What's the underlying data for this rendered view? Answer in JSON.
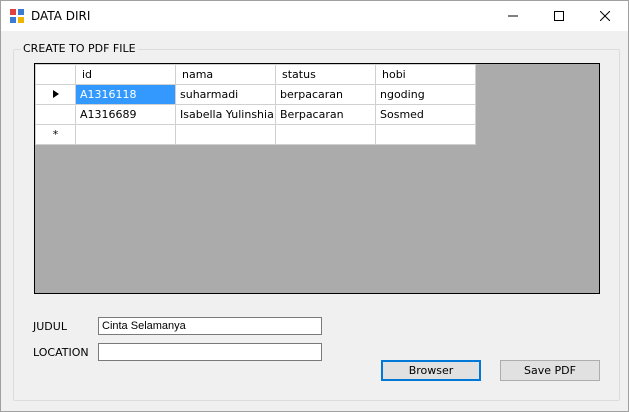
{
  "window": {
    "title": "DATA DIRI"
  },
  "group": {
    "title": "CREATE TO PDF FILE"
  },
  "grid": {
    "columns": [
      "id",
      "nama",
      "status",
      "hobi"
    ],
    "rows": [
      {
        "id": "A1316118",
        "nama": "suharmadi",
        "status": "berpacaran",
        "hobi": "ngoding"
      },
      {
        "id": "A1316689",
        "nama": "Isabella Yulinshia...",
        "status": "Berpacaran",
        "hobi": "Sosmed"
      }
    ],
    "new_row_marker": "*"
  },
  "form": {
    "judul_label": "JUDUL",
    "judul_value": "Cinta Selamanya",
    "location_label": "LOCATION",
    "location_value": ""
  },
  "buttons": {
    "browser": "Browser",
    "save_pdf": "Save PDF"
  },
  "colors": {
    "selection": "#3399ff",
    "grid_bg": "#ababab",
    "accent": "#0078d7"
  }
}
